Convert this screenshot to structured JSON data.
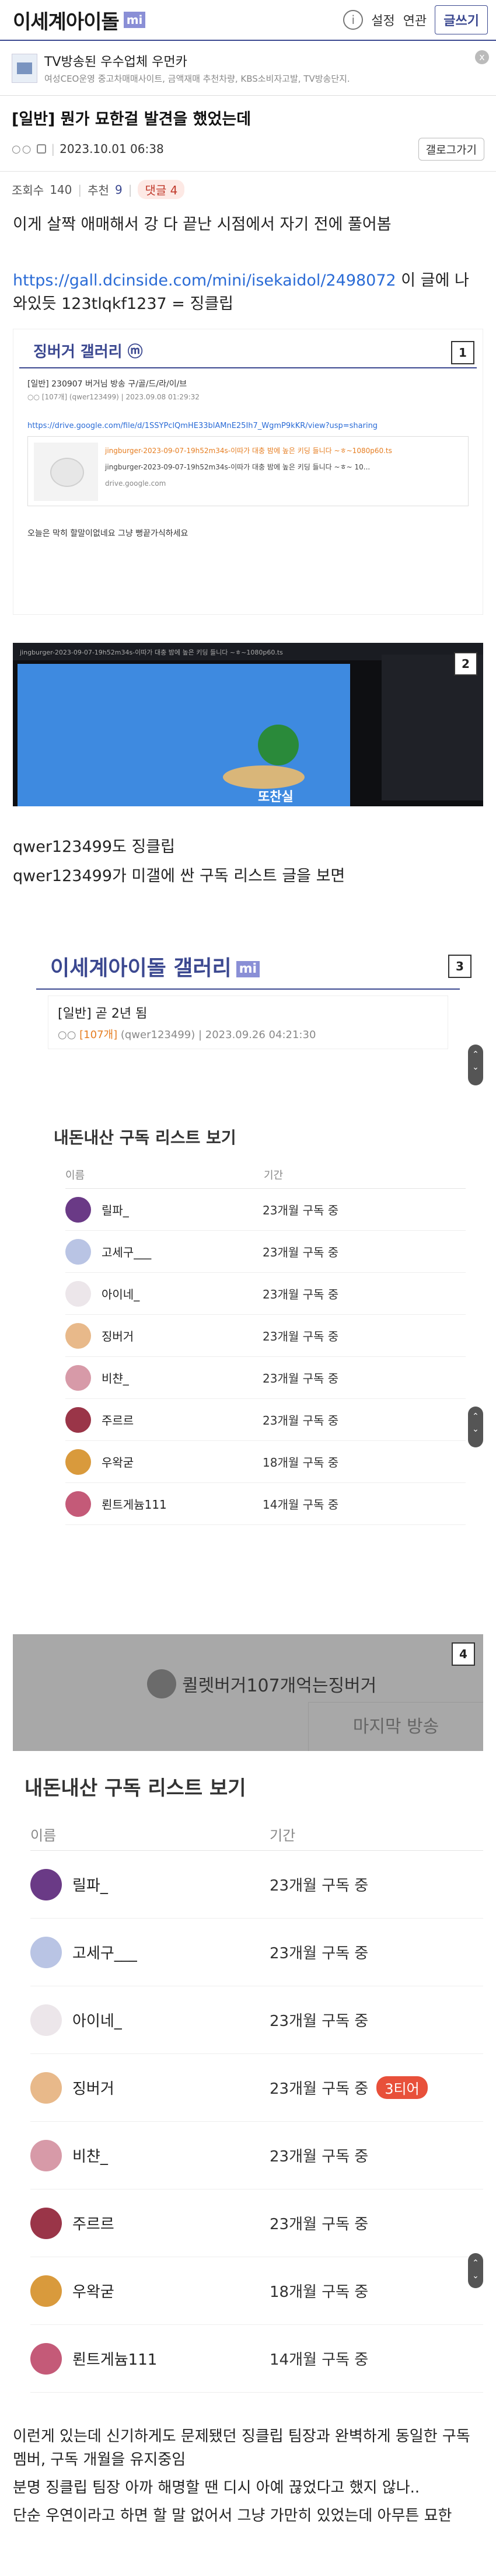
{
  "header": {
    "title": "이세계아이돌",
    "badge": "mi",
    "info_icon": "info-icon",
    "settings": "설정",
    "related": "연관",
    "write": "글쓰기"
  },
  "ad": {
    "title": "TV방송된 우수업체 우먼카",
    "subtitle": "여성CEO운영 중고차매매사이트, 금액재매 추천차량, KBS소비자고발, TV방송단지.",
    "close": "x"
  },
  "post": {
    "title": "[일반] 뭔가 묘한걸 발견을 했었는데",
    "author_dots": "○○",
    "date": "2023.10.01 06:38",
    "list_button": "갤로그가기",
    "views_label": "조회수",
    "views": "140",
    "recommend_label": "추천",
    "recommend": "9",
    "comments_label": "댓글",
    "comments": "4",
    "p1": "이게 살짝 애매해서 강 다 끝난 시점에서 자기 전에 풀어봄",
    "link_url": "https://gall.dcinside.com/mini/isekaidol/2498072",
    "p2_suffix": " 이 글에 나와있듯 123tlqkf1237 = 징클립",
    "p3": "qwer123499도 징클립",
    "p4": "qwer123499가 미갤에 싼 구독 리스트 글을 보면",
    "p5": "이런게 있는데 신기하게도 문제됐던 징클립 팀장과 완벽하게 동일한 구독 멤버, 구독 개월을 유지중임",
    "p6": "분명 징클립 팀장 아까 해명할 땐 디시 아예 끊었다고 했지 않나..",
    "p7": "단순 우연이라고 하면 할 말 없어서 그냥 가만히 있었는데 아무튼 묘한"
  },
  "shot1": {
    "num": "1",
    "gallery": "징버거 갤러리",
    "gallery_badge": "ⓜ",
    "post_line": "[일반] 230907 버거님 방송 구/골/드/라/이/브",
    "meta": "○○ [107개] (qwer123499) | 2023.09.08 01:29:32",
    "url": "https://drive.google.com/file/d/1SSYPclQmHE33blAMnE25Ih7_WgmP9kKR/view?usp=sharing",
    "card_line1": "jingburger-2023-09-07-19h52m34s-이따가 대충 밤에 높은 키딩 들니다 ~ㅎ~1080p60.ts",
    "card_line2": "jingburger-2023-09-07-19h52m34s-이따가 대충 밤에 높은 키딩 들니다 ~ㅎ~ 10...",
    "card_line3": "drive.google.com",
    "footer": "오늘은 막히 할말이없네요 그냥 뻥끝가식하세요"
  },
  "shot2": {
    "num": "2",
    "bar_text": "jingburger-2023-09-07-19h52m34s-이따가 대충 밤에 높은 키딩 들니다 ~ㅎ~1080p60.ts",
    "caption": "또찬실"
  },
  "shot3": {
    "num": "3",
    "gallery": "이세계아이돌 갤러리",
    "badge": "mi",
    "post_title": "[일반] 곧 2년 됨",
    "dots": "○○",
    "post_count": "[107개]",
    "post_user": "(qwer123499)",
    "post_date": "| 2023.09.26 04:21:30",
    "list_title": "내돈내산 구독 리스트 보기",
    "col_name": "이름",
    "col_period": "기간",
    "rows": [
      {
        "name": "릴파_",
        "dur": "23개월 구독 중",
        "color": "#6a3a86"
      },
      {
        "name": "고세구___",
        "dur": "23개월 구독 중",
        "color": "#b9c4e4"
      },
      {
        "name": "아이네_",
        "dur": "23개월 구독 중",
        "color": "#ece6ea"
      },
      {
        "name": "징버거",
        "dur": "23개월 구독 중",
        "color": "#e8b98a"
      },
      {
        "name": "비챤_",
        "dur": "23개월 구독 중",
        "color": "#d79aa8"
      },
      {
        "name": "주르르",
        "dur": "23개월 구독 중",
        "color": "#9a3548"
      },
      {
        "name": "우왁굳",
        "dur": "18개월 구독 중",
        "color": "#d99a3c"
      },
      {
        "name": "뢴트게늄111",
        "dur": "14개월 구독 중",
        "color": "#c45a78"
      }
    ],
    "scroll_up": "⌃",
    "scroll_down": "⌄"
  },
  "shot4": {
    "num": "4",
    "streamer_line": "퀼렛버거107개억는징버거",
    "last_stream": "마지막 방송",
    "list_title": "내돈내산 구독 리스트 보기",
    "col_name": "이름",
    "col_period": "기간",
    "tier_label": "3티어",
    "rows": [
      {
        "name": "릴파_",
        "dur": "23개월 구독 중",
        "color": "#6a3a86"
      },
      {
        "name": "고세구___",
        "dur": "23개월 구독 중",
        "color": "#b9c4e4"
      },
      {
        "name": "아이네_",
        "dur": "23개월 구독 중",
        "color": "#ece6ea"
      },
      {
        "name": "징버거",
        "dur": "23개월 구독 중",
        "color": "#e8b98a"
      },
      {
        "name": "비챤_",
        "dur": "23개월 구독 중",
        "color": "#d79aa8"
      },
      {
        "name": "주르르",
        "dur": "23개월 구독 중",
        "color": "#9a3548"
      },
      {
        "name": "우왁굳",
        "dur": "18개월 구독 중",
        "color": "#d99a3c"
      },
      {
        "name": "뢴트게늄111",
        "dur": "14개월 구독 중",
        "color": "#c45a78"
      }
    ]
  },
  "colors": {
    "accent": "#3b4890",
    "tier": "#e8503a",
    "link": "#2a6bd6"
  }
}
